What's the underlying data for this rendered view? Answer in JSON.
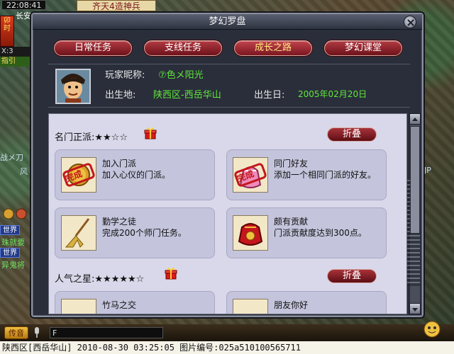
{
  "hud": {
    "time": "22:08:41",
    "hour_glyph": "卯时",
    "city": "长安城",
    "coord": "X:3",
    "guide": "指引"
  },
  "top_banner": "齐天4造神兵",
  "background_text": {
    "left_war": "战メ刀",
    "left_wind": "风",
    "right_jp": "JP"
  },
  "chat": {
    "tags": [
      "世界",
      "世界"
    ],
    "lines": [
      "珠就要",
      "异鬼将"
    ],
    "send_label": "传音",
    "input_value": "F"
  },
  "status_bar": "陕西区[西岳华山] 2010-08-30 03:25:05 图片编号:025a510100565711",
  "dialog": {
    "title": "梦幻罗盘",
    "tabs": [
      {
        "label": "日常任务",
        "active": false
      },
      {
        "label": "支线任务",
        "active": false
      },
      {
        "label": "成长之路",
        "active": true
      },
      {
        "label": "梦幻课堂",
        "active": false
      }
    ],
    "profile": {
      "nickname_label": "玩家昵称:",
      "nickname": "⑦色メ阳光",
      "birthplace_label": "出生地:",
      "birthplace": "陕西区-西岳华山",
      "birthday_label": "出生日:",
      "birthday": "2005年02月20日"
    },
    "sections": [
      {
        "title": "名门正派:★★☆☆",
        "fold_label": "折叠",
        "cards": [
          {
            "title": "加入门派",
            "desc": "加入心仪的门派。",
            "stamp": "完成",
            "icon": "seal-stamp-icon"
          },
          {
            "title": "同门好友",
            "desc": "添加一个相同门派的好友。",
            "stamp": "完成",
            "icon": "pink-pouch-icon"
          },
          {
            "title": "勤学之徒",
            "desc": "完成200个师门任务。",
            "stamp": "",
            "icon": "broom-icon"
          },
          {
            "title": "颇有贡献",
            "desc": "门派贡献度达到300点。",
            "stamp": "",
            "icon": "red-pouch-icon"
          }
        ]
      },
      {
        "title": "人气之星:★★★★★☆",
        "fold_label": "折叠",
        "cards": [
          {
            "title": "竹马之交",
            "desc": "",
            "stamp": "",
            "icon": "scroll-icon"
          },
          {
            "title": "朋友你好",
            "desc": "",
            "stamp": "",
            "icon": "scroll-icon"
          }
        ]
      }
    ]
  },
  "colors": {
    "tab_red": "#8a1a22",
    "panel_bg": "#d8d8ea",
    "card_bg": "#c4c4dc",
    "green_text": "#5fe83a",
    "stamp_red": "#c4161c"
  }
}
